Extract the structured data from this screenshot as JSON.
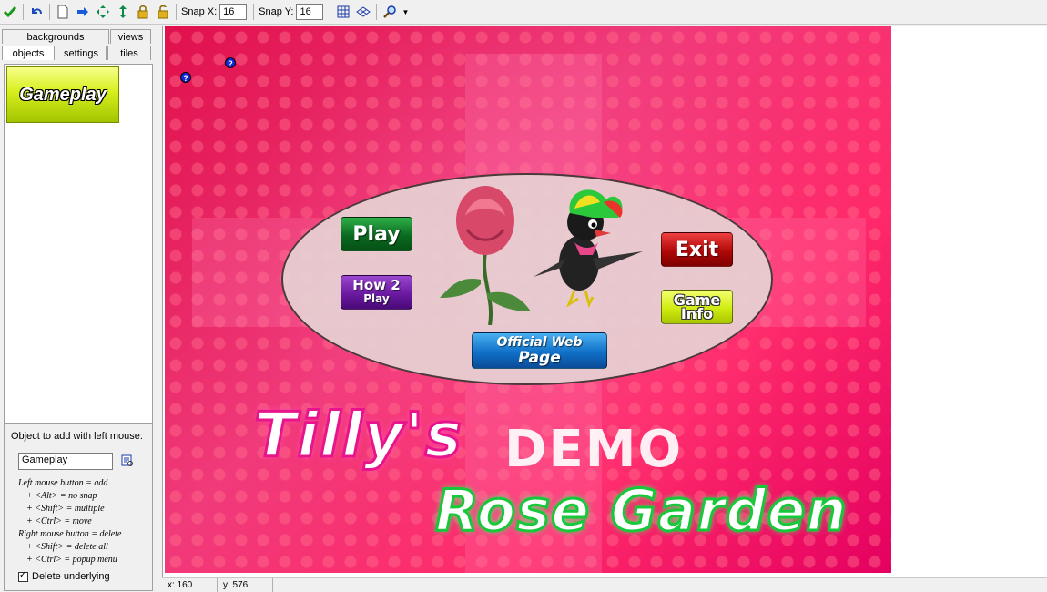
{
  "toolbar": {
    "snap_x_label": "Snap X:",
    "snap_x_value": "16",
    "snap_y_label": "Snap Y:",
    "snap_y_value": "16",
    "icons": [
      "check-icon",
      "undo-icon",
      "new-icon",
      "arrow-right-icon",
      "shift-icon",
      "shift-vertical-icon",
      "lock-icon",
      "unlock-icon",
      "grid-icon",
      "isometric-icon",
      "zoom-icon"
    ]
  },
  "left_panel": {
    "tabs_top": [
      "backgrounds",
      "views"
    ],
    "tabs_bottom": [
      "objects",
      "settings",
      "tiles"
    ],
    "active_tab": "objects",
    "object_thumbnail_label": "Gameplay",
    "add_label": "Object to add with left mouse:",
    "object_value": "Gameplay",
    "help_lines": [
      "Left mouse button = add",
      "+ <Alt> = no snap",
      "+ <Shift> = multiple",
      "+ <Ctrl> = move",
      "Right mouse button = delete",
      "+ <Shift> = delete all",
      "+ <Ctrl> = popup menu"
    ],
    "delete_underlying_label": "Delete underlying",
    "delete_underlying_checked": true
  },
  "room": {
    "buttons": {
      "play": "Play",
      "how_line1": "How 2",
      "how_line2": "Play",
      "exit": "Exit",
      "info_line1": "Game",
      "info_line2": "Info",
      "web_line1": "Official Web",
      "web_line2": "Page"
    },
    "title_tilly": "Tilly's",
    "title_demo": "DEMO",
    "title_rose": "Rose Garden",
    "qmark": "?"
  },
  "status": {
    "x": "x: 160",
    "y": "y: 576"
  }
}
